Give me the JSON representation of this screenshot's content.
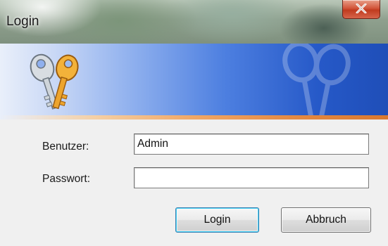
{
  "window": {
    "title": "Login",
    "close_icon": "close-x-icon"
  },
  "banner": {
    "logo_icon": "keys-icon",
    "colors": {
      "gradient_start": "#e9effa",
      "gradient_end": "#1f4eb8",
      "accent_stripe": "#f0a766"
    }
  },
  "form": {
    "user_label": "Benutzer:",
    "user_value": "Admin",
    "password_label": "Passwort:",
    "password_value": ""
  },
  "buttons": {
    "login_label": "Login",
    "cancel_label": "Abbruch"
  }
}
